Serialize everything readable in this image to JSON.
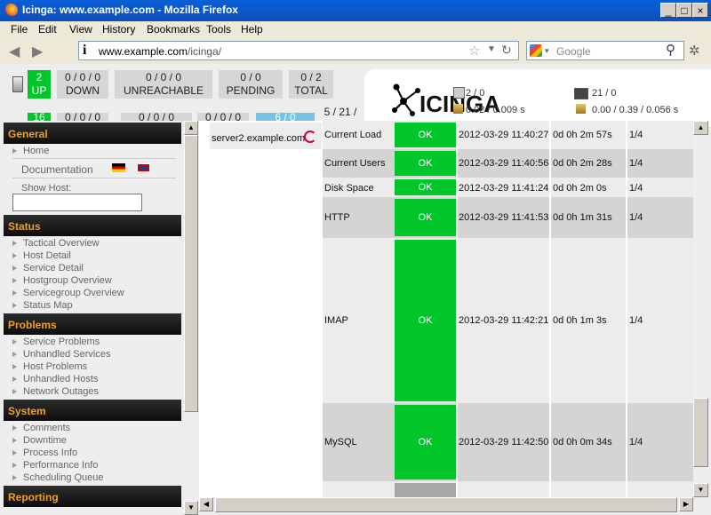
{
  "window": {
    "title": "Icinga: www.example.com - Mozilla Firefox"
  },
  "menu": [
    "File",
    "Edit",
    "View",
    "History",
    "Bookmarks",
    "Tools",
    "Help"
  ],
  "nav": {
    "url_host": "www.example.com",
    "url_path": "/icinga/",
    "search_placeholder": "Google"
  },
  "hosts": {
    "up": {
      "count": "2",
      "label": "UP"
    },
    "down": {
      "counts": "0 / 0 / 0",
      "label": "DOWN"
    },
    "unreachable": {
      "counts": "0 / 0 / 0",
      "label": "UNREACHABLE"
    },
    "pending": {
      "counts": "0 / 0",
      "label": "PENDING"
    },
    "total": {
      "counts": "0 / 2",
      "label": "TOTAL"
    }
  },
  "services_row": {
    "ok": "16",
    "c1": "0 / 0 / 0",
    "c2": "0 / 0 / 0",
    "c3": "0 / 0 / 0",
    "c4": "6 / 0",
    "c5": "5 / 21 /"
  },
  "logo_stats": {
    "s1": "2 / 0",
    "s2": "0.02 / 0.009 s",
    "s3": "21 / 0",
    "s4": "0.00 / 0.39 / 0.056 s"
  },
  "sidebar": {
    "general": {
      "title": "General",
      "home": "Home",
      "documentation": "Documentation",
      "show_host": "Show Host:"
    },
    "status": {
      "title": "Status",
      "items": [
        "Tactical Overview",
        "Host Detail",
        "Service Detail",
        "Hostgroup Overview",
        "Servicegroup Overview",
        "Status Map"
      ]
    },
    "problems": {
      "title": "Problems",
      "items": [
        "Service Problems",
        "Unhandled Services",
        "Host Problems",
        "Unhandled Hosts",
        "Network Outages"
      ]
    },
    "system": {
      "title": "System",
      "items": [
        "Comments",
        "Downtime",
        "Process Info",
        "Performance Info",
        "Scheduling Queue"
      ]
    },
    "reporting": {
      "title": "Reporting"
    }
  },
  "table": {
    "host": "server2.example.com",
    "rows": [
      {
        "service": "Current Load",
        "status": "OK",
        "last_check": "2012-03-29 11:40:27",
        "duration": "0d 0h 2m 57s",
        "attempt": "1/4"
      },
      {
        "service": "Current Users",
        "status": "OK",
        "last_check": "2012-03-29 11:40:56",
        "duration": "0d 0h 2m 28s",
        "attempt": "1/4"
      },
      {
        "service": "Disk Space",
        "status": "OK",
        "last_check": "2012-03-29 11:41:24",
        "duration": "0d 0h 2m 0s",
        "attempt": "1/4"
      },
      {
        "service": "HTTP",
        "status": "OK",
        "last_check": "2012-03-29 11:41:53",
        "duration": "0d 0h 1m 31s",
        "attempt": "1/4"
      },
      {
        "service": "IMAP",
        "status": "OK",
        "last_check": "2012-03-29 11:42:21",
        "duration": "0d 0h 1m 3s",
        "attempt": "1/4"
      },
      {
        "service": "MySQL",
        "status": "OK",
        "last_check": "2012-03-29 11:42:50",
        "duration": "0d 0h 0m 34s",
        "attempt": "1/4"
      }
    ]
  },
  "colors": {
    "ok": "#00c62a",
    "header_text": "#f0a020",
    "pending_blue": "#75c4e2"
  }
}
